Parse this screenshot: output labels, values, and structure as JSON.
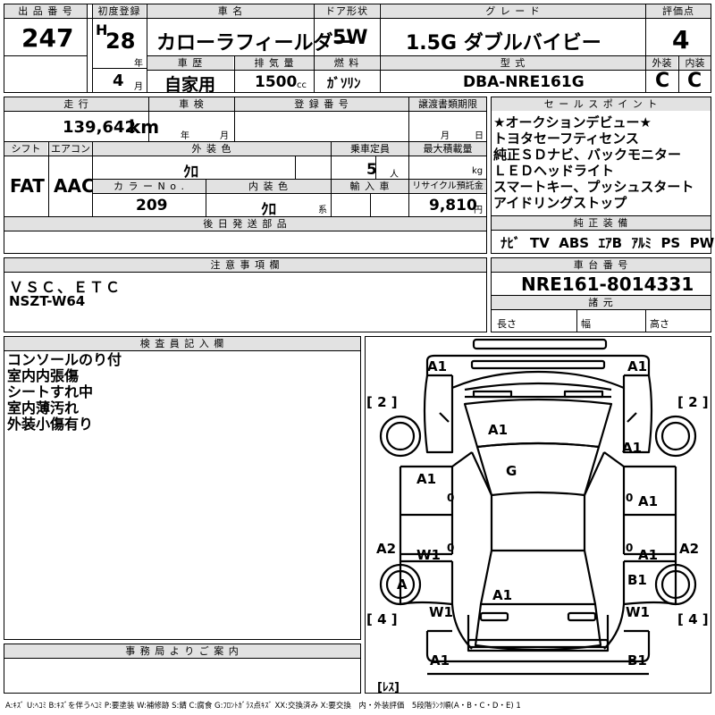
{
  "header": {
    "lot_label": "出 品 番 号",
    "lot_no": "247",
    "first_reg_label": "初度登録",
    "era": "H",
    "year": "28",
    "year_unit": "年",
    "month": "4",
    "month_unit": "月",
    "name_label": "車 名",
    "car_name": "カローラフィールダー",
    "door_label": "ドア形状",
    "door": "5W",
    "grade_label": "グ レ ー ド",
    "grade": "1.5G ダブルバイビー",
    "score_label": "評価点",
    "score": "4",
    "history_label": "車 歴",
    "history": "自家用",
    "disp_label": "排 気 量",
    "displacement": "1500",
    "disp_unit": "cc",
    "fuel_label": "燃 料",
    "fuel": "ｶﾞｿﾘﾝ",
    "model_label": "型 式",
    "model": "DBA-NRE161G",
    "ext_label": "外装",
    "int_label": "内装",
    "ext_grade": "C",
    "int_grade": "C"
  },
  "row2": {
    "mileage_label": "走 行",
    "mileage": "139,642",
    "mileage_unit": "km",
    "inspection_label": "車 検",
    "insp_year_unit": "年",
    "insp_month_unit": "月",
    "plate_label": "登 録 番 号",
    "deadline_label": "譲渡書類期限",
    "deadline_month_unit": "月",
    "deadline_day_unit": "日",
    "shift_label": "シフト",
    "aircon_label": "エアコン",
    "shift": "FAT",
    "aircon": "AAC",
    "color_label": "外 装 色",
    "color": "ｸﾛ",
    "capacity_label": "乗車定員",
    "capacity": "5",
    "capacity_unit": "人",
    "load_label": "最大積載量",
    "load_unit": "kg",
    "colorno_label": "カ ラ ー N o .",
    "colorno": "209",
    "intcolor_label": "内 装 色",
    "intcolor": "ｸﾛ",
    "intcolor_unit": "系",
    "import_label": "輸 入 車",
    "recycle_label": "リサイクル預託金",
    "recycle": "9,810",
    "recycle_unit": "円",
    "parts_label": "後 日 発 送 部 品"
  },
  "sales": {
    "label": "セ ー ル ス ポ イ ン ト",
    "lines": [
      "★オークションデビュー★",
      "トヨタセーフティセンス",
      "純正ＳＤナビ、バックモニター",
      "ＬＥＤヘッドライト",
      "スマートキー、プッシュスタート",
      "アイドリングストップ"
    ],
    "equip_label": "純 正 装 備",
    "equipment": [
      "ﾅﾋﾞ",
      "TV",
      "ABS",
      "ｴｱB",
      "ｱﾙﾐ",
      "PS",
      "PW"
    ]
  },
  "notes": {
    "label": "注 意 事 項 欄",
    "line1": "ＶＳＣ、ＥＴＣ",
    "line2": "NSZT-W64"
  },
  "chassis": {
    "label": "車 台 番 号",
    "number": "NRE161-8014331",
    "spec_label": "諸 元",
    "length_label": "長さ",
    "width_label": "幅",
    "height_label": "高さ"
  },
  "inspector": {
    "label": "検 査 員 記 入 欄",
    "lines": [
      "コンソールのり付",
      "室内内張傷",
      "シートすれ中",
      "室内薄汚れ",
      "外装小傷有り"
    ]
  },
  "office": {
    "label": "事 務 局 よ り ご 案 内"
  },
  "diagram": {
    "bracket_left_top": "[ 2 ]",
    "bracket_right_top": "[ 2 ]",
    "bracket_left_bottom": "[ 4 ]",
    "bracket_right_bottom": "[ 4 ]",
    "les": "[ﾚｽ]",
    "marks": {
      "front_bumper_left": "A1",
      "front_bumper_right": "A1",
      "hood": "A1",
      "front_fender_right": "A1",
      "windshield": "G",
      "front_door_left": "A1",
      "front_door_right": "A1",
      "front_door_left_zero": "0",
      "front_door_right_zero": "0",
      "rear_door_left_zero": "0",
      "rear_door_right_zero": "0",
      "rocker_left": "A2",
      "rocker_right": "A2",
      "rear_door_left": "W1",
      "rear_door_right": "A1",
      "rear_wheel_left": "A",
      "quarter_right": "B1",
      "trunk": "A1",
      "quarter_left": "W1",
      "quarter_right_lower": "W1",
      "rear_bumper_left": "A1",
      "rear_bumper_right": "B1"
    }
  },
  "legend": "A:ｷｽﾞ U:ﾍｺﾐ B:ｷｽﾞを伴うﾍｺﾐ P:要塗装 W:補修跡 S:錆 C:腐食 G:ﾌﾛﾝﾄｶﾞﾗｽ点ｷｽﾞ XX:交換済み X:要交換　内・外装評価　5段階ﾗﾝｸ順(A・B・C・D・E) 1"
}
